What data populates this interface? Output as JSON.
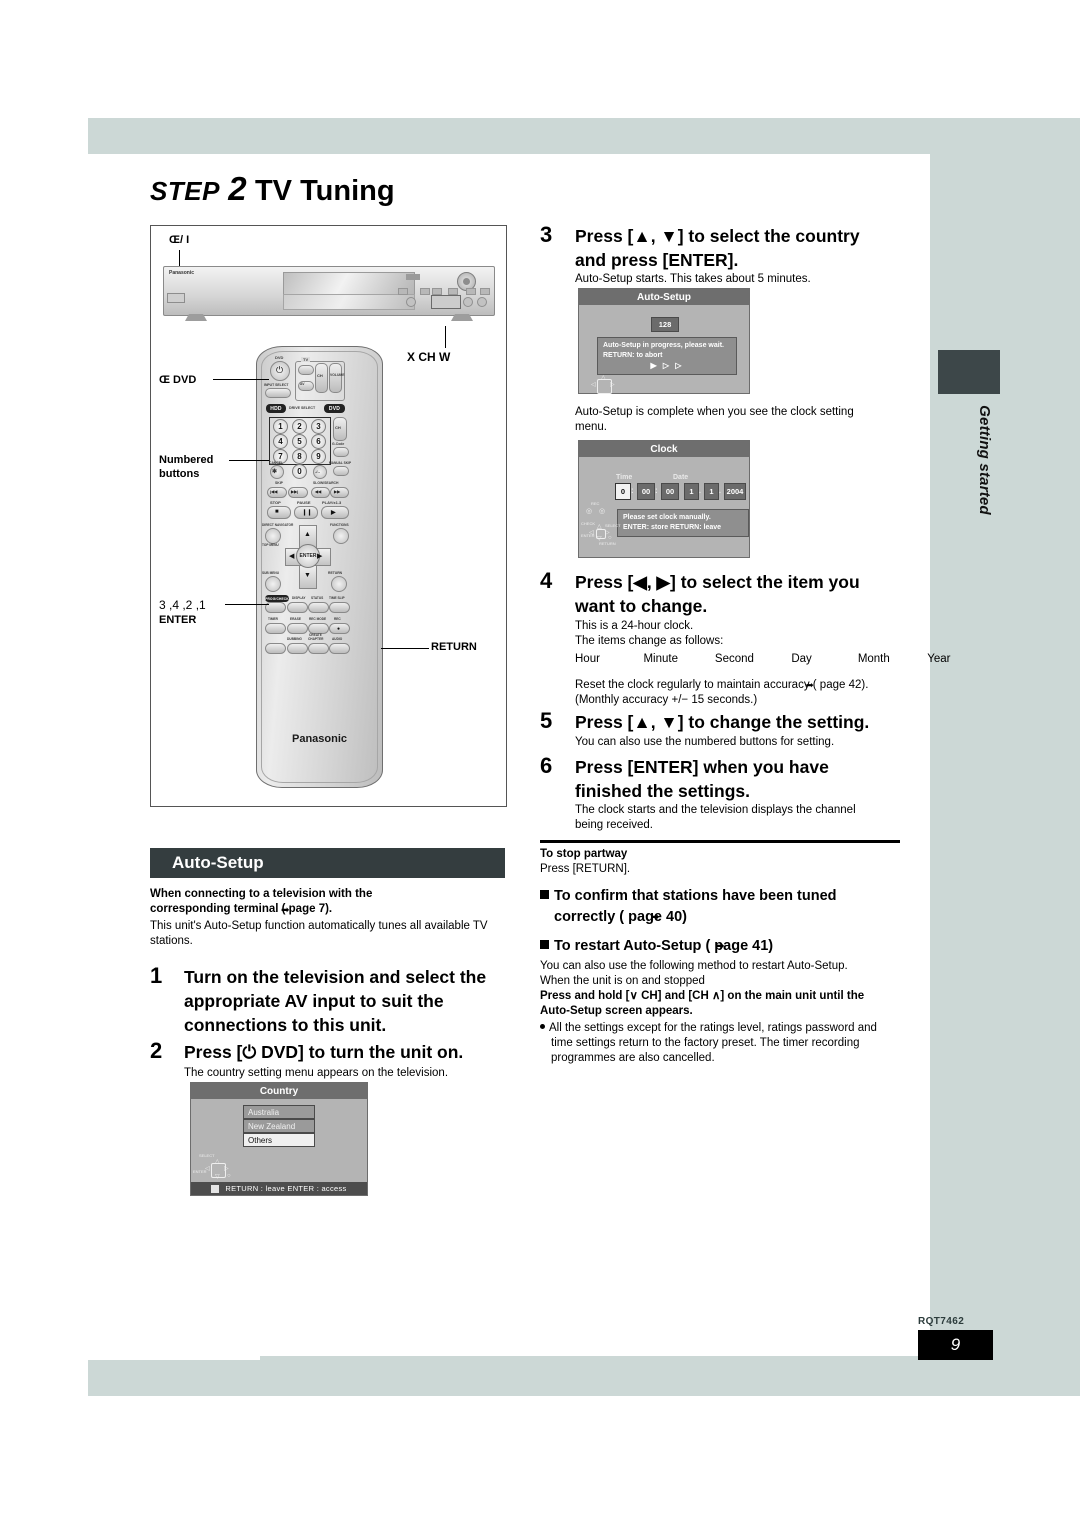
{
  "page": {
    "title_step": "STEP",
    "title_num": "2",
    "title_rest": "TV Tuning",
    "side_tab_label": "Getting started",
    "footer_code": "RQT7462",
    "footer_page": "9"
  },
  "figure": {
    "unit_brand": "Panasonic",
    "power_label": "Œ/ I",
    "ch_label": "X  CH  W",
    "dvd_power_label": "Œ DVD",
    "numbered_label_l1": "Numbered",
    "numbered_label_l2": "buttons",
    "enter_label_l1": "3 ,4 ,2 ,1",
    "enter_label_l2": "ENTER",
    "return_label": "RETURN",
    "remote": {
      "brand": "Panasonic",
      "dvd_top": "DVD",
      "tv_group": "TV",
      "input_select": "INPUT SELECT",
      "av": "AV",
      "ch": "CH",
      "volume": "VOLUME",
      "hdd": "HDD",
      "drive_select": "DRIVE SELECT",
      "dvd": "DVD",
      "gcode": "G-Code",
      "manual_skip": "MANUAL SKIP",
      "cancel": "CANCEL",
      "skip": "SKIP",
      "slow_search": "SLOW/SEARCH",
      "stop": "STOP",
      "pause": "PAUSE",
      "play": "PLAY/x1.3",
      "direct_navigator": "DIRECT NAVIGATOR",
      "top_menu": "TOP MENU",
      "functions": "FUNCTIONS",
      "sub_menu": "SUB MENU",
      "return": "RETURN",
      "enter": "ENTER",
      "prog_record": "PROG/CHECK",
      "display": "DISPLAY",
      "status": "STATUS",
      "time_slip": "TIME SLIP",
      "timer": "TIMER",
      "erase": "ERASE",
      "rec_mode": "REC MODE",
      "rec": "REC",
      "dubbing": "DUBBING",
      "create_chapter_l1": "CREATE",
      "create_chapter_l2": "CHAPTER",
      "audio": "AUDIO",
      "numbers": [
        "1",
        "2",
        "3",
        "4",
        "5",
        "6",
        "7",
        "8",
        "9",
        "0"
      ],
      "minus": "-/--"
    }
  },
  "autosetup_section": {
    "heading": "Auto-Setup",
    "intro_bold_l1": "When connecting to a television with the",
    "intro_bold_l2": "corresponding terminal (    page 7).",
    "intro_l1": "This unit's Auto-Setup function automatically tunes all available TV",
    "intro_l2": "stations."
  },
  "steps": {
    "s1": {
      "num": "1",
      "l1": "Turn on the television and select the",
      "l2": "appropriate AV input to suit the",
      "l3": "connections to this unit."
    },
    "s2": {
      "num": "2",
      "l1": "Press [⏻ DVD] to turn the unit on.",
      "sub": "The country setting menu appears on the television."
    },
    "s3": {
      "num": "3",
      "l1": "Press [▲, ▼] to select the country",
      "l2": "and press [ENTER].",
      "sub": "Auto-Setup starts. This takes about 5 minutes.",
      "sub2_l1": "Auto-Setup is complete when you see the clock setting",
      "sub2_l2": "menu."
    },
    "s4": {
      "num": "4",
      "l1": "Press [◀, ▶] to select the item you",
      "l2": "want to change.",
      "sub1": "This is a 24-hour clock.",
      "sub2": "The items change as follows:",
      "items": [
        "Hour",
        "Minute",
        "Second",
        "Day",
        "Month",
        "Year"
      ],
      "note_l1": "Reset the clock regularly to maintain accuracy (    page 42).",
      "note_l2": "(Monthly accuracy +/− 15 seconds.)"
    },
    "s5": {
      "num": "5",
      "l1": "Press [▲, ▼] to change the setting.",
      "sub": "You can also use the numbered buttons for setting."
    },
    "s6": {
      "num": "6",
      "l1": "Press [ENTER] when you have",
      "l2": "finished the settings.",
      "sub_l1": "The clock starts and the television displays the channel",
      "sub_l2": "being received."
    }
  },
  "stop_partway": {
    "heading": "To stop partway",
    "body": "Press [RETURN]."
  },
  "confirm_block": {
    "heading_l1": "To confirm that stations have been tuned",
    "heading_l2": "correctly (    page 40)"
  },
  "restart_block": {
    "heading": "To restart Auto-Setup (    page 41)",
    "l1": "You can also use the following method to restart Auto-Setup.",
    "l2": "When the unit is on and stopped",
    "b1": "Press and hold [∨ CH] and [CH ∧] on the main unit until the",
    "b2": "Auto-Setup screen appears.",
    "bullet_l1": "All the settings except for the ratings level, ratings password and",
    "bullet_l2": "time settings return to the factory preset. The timer recording",
    "bullet_l3": "programmes are also cancelled."
  },
  "osd": {
    "country": {
      "title": "Country",
      "options": [
        "Australia",
        "New Zealand",
        "Others"
      ],
      "footer": "RETURN : leave    ENTER : access",
      "nav_select": "SELECT",
      "nav_enter": "ENTER",
      "nav_return": "RETURN"
    },
    "autosetup": {
      "title": "Auto-Setup",
      "channel": "128",
      "msg_l1": "Auto-Setup in progress, please wait.",
      "msg_l2": "RETURN: to abort",
      "progress": "▶ ▷ ▷"
    },
    "clock": {
      "title": "Clock",
      "time_label": "Time",
      "date_label": "Date",
      "hour": "0",
      "minute": "00",
      "second": "00",
      "day": "1",
      "month": "1",
      "year": "2004",
      "msg_l1": "Please set clock manually.",
      "msg_l2": "ENTER: store    RETURN: leave",
      "nav_rec": "REC",
      "nav_check": "CHECK",
      "nav_select": "SELECT",
      "nav_enter": "ENTER",
      "nav_return": "RETURN"
    }
  },
  "colors": {
    "band": "#ccd8d6",
    "section_bar": "#343d3f",
    "osd_bg": "#b4b4b4",
    "osd_title": "#6e6e6e"
  }
}
